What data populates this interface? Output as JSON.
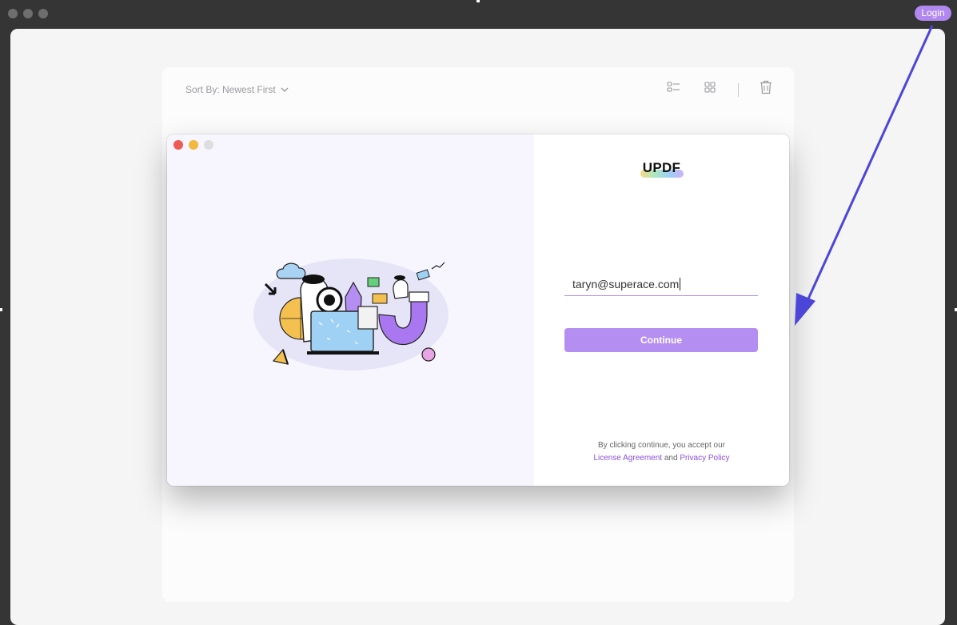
{
  "topbar": {
    "login_label": "Login"
  },
  "library": {
    "sort_label": "Sort By: Newest First",
    "icons": [
      "list-view-icon",
      "grid-view-icon",
      "trash-icon"
    ]
  },
  "modal": {
    "logo": "UPDF",
    "email_value": "taryn@superace.com",
    "continue_label": "Continue",
    "legal_prefix": "By clicking continue, you accept our",
    "license_link": "License Agreement",
    "and_text": "and",
    "privacy_link": "Privacy Policy"
  },
  "colors": {
    "accent": "#b58ef2",
    "link": "#8a4fe0",
    "annotation_arrow": "#4c46d8"
  }
}
